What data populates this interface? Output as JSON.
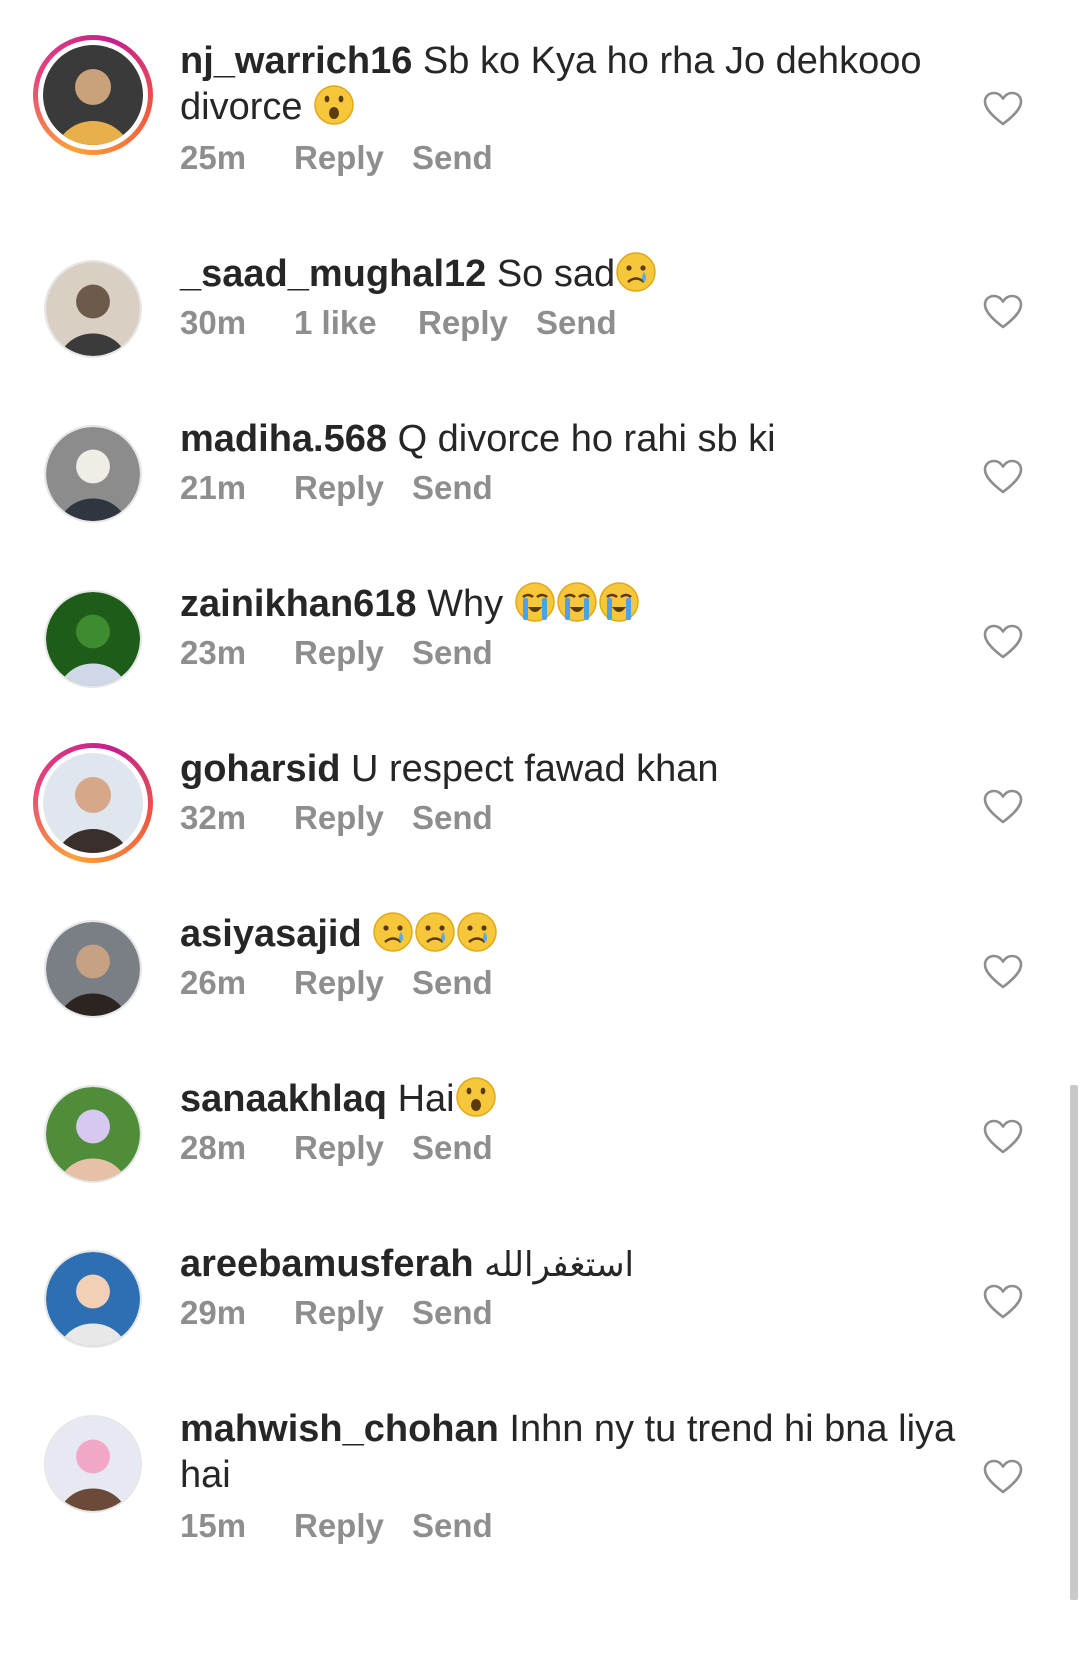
{
  "comments": [
    {
      "username": "nj_warrich16",
      "text": "Sb ko Kya ho rha Jo dehkooo divorce ",
      "emojis": [
        "😮"
      ],
      "time": "25m",
      "likes": "",
      "reply": "Reply",
      "send": "Send",
      "avatar": "avatar-woman-selfie",
      "story_ring": true
    },
    {
      "username": "_saad_mughal12",
      "text": "So sad",
      "emojis": [
        "😢"
      ],
      "time": "30m",
      "likes": "1 like",
      "reply": "Reply",
      "send": "Send",
      "avatar": "avatar-man-outdoors",
      "story_ring": false
    },
    {
      "username": "madiha.568",
      "text": "Q divorce ho rahi sb ki",
      "emojis": [],
      "time": "21m",
      "likes": "",
      "reply": "Reply",
      "send": "Send",
      "avatar": "avatar-wedding-couple",
      "story_ring": false
    },
    {
      "username": "zainikhan618",
      "text": "Why ",
      "emojis": [
        "😭",
        "😭",
        "😭"
      ],
      "time": "23m",
      "likes": "",
      "reply": "Reply",
      "send": "Send",
      "avatar": "avatar-man-grass",
      "story_ring": false
    },
    {
      "username": "goharsid",
      "text": "U respect fawad khan",
      "emojis": [],
      "time": "32m",
      "likes": "",
      "reply": "Reply",
      "send": "Send",
      "avatar": "avatar-man-smiling",
      "story_ring": true
    },
    {
      "username": "asiyasajid",
      "text": " ",
      "emojis": [
        "😢",
        "😢",
        "😢"
      ],
      "time": "26m",
      "likes": "",
      "reply": "Reply",
      "send": "Send",
      "avatar": "avatar-woman-portrait",
      "story_ring": false
    },
    {
      "username": "sanaakhlaq",
      "text": "Hai",
      "emojis": [
        "😮"
      ],
      "time": "28m",
      "likes": "",
      "reply": "Reply",
      "send": "Send",
      "avatar": "avatar-child-hoodie",
      "story_ring": false
    },
    {
      "username": "areebamusferah",
      "text": "استغفرالله",
      "emojis": [],
      "time": "29m",
      "likes": "",
      "reply": "Reply",
      "send": "Send",
      "avatar": "avatar-baby",
      "story_ring": false,
      "rtl": true
    },
    {
      "username": "mahwish_chohan",
      "text": "Inhn ny tu trend hi bna liya hai",
      "emojis": [],
      "time": "15m",
      "likes": "",
      "reply": "Reply",
      "send": "Send",
      "avatar": "avatar-girl-pink",
      "story_ring": false
    }
  ],
  "colors": {
    "text": "#262626",
    "meta": "#8e8e8e",
    "story_ring_start": "#f9a23a",
    "story_ring_end": "#c51f8e"
  },
  "icons": {
    "like": "heart-outline-icon"
  }
}
